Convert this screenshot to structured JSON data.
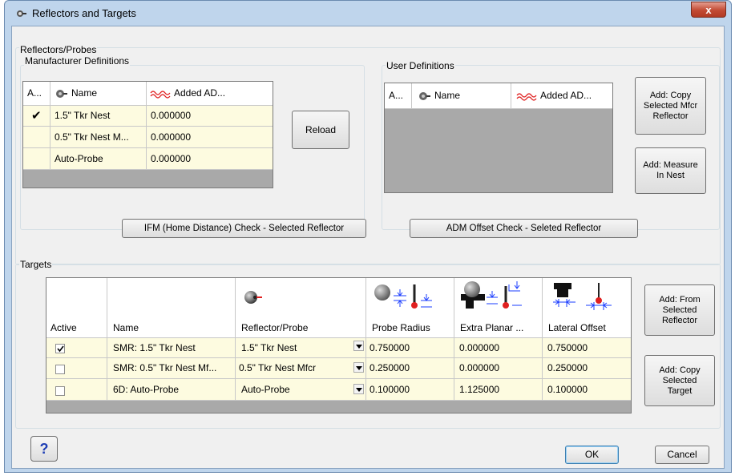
{
  "window": {
    "title": "Reflectors and Targets",
    "close": "x"
  },
  "reflectors": {
    "group_label": "Reflectors/Probes",
    "manufacturer": {
      "label": "Manufacturer Definitions",
      "columns": [
        "A...",
        "Name",
        "Added AD..."
      ],
      "rows": [
        {
          "active": "✔",
          "name": "1.5\" Tkr Nest",
          "added": "0.000000"
        },
        {
          "active": "",
          "name": "0.5\" Tkr Nest M...",
          "added": "0.000000"
        },
        {
          "active": "",
          "name": "Auto-Probe",
          "added": "0.000000"
        }
      ]
    },
    "reload_label": "Reload",
    "user": {
      "label": "User Definitions",
      "columns": [
        "A...",
        "Name",
        "Added AD..."
      ]
    },
    "add_copy_mfcr": [
      "Add: Copy",
      "Selected Mfcr",
      "Reflector"
    ],
    "add_measure": [
      "Add: Measure",
      "In Nest"
    ],
    "ifm_check_label": "IFM (Home Distance) Check - Selected Reflector",
    "adm_check_label": "ADM Offset Check - Seleted Reflector"
  },
  "targets": {
    "group_label": "Targets",
    "columns": [
      "Active",
      "Name",
      "Reflector/Probe",
      "Probe Radius",
      "Extra Planar ...",
      "Lateral Offset"
    ],
    "rows": [
      {
        "active": true,
        "name": "SMR: 1.5\" Tkr Nest",
        "reflector": "1.5\" Tkr Nest",
        "radius": "0.750000",
        "extra": "0.000000",
        "lateral": "0.750000"
      },
      {
        "active": false,
        "name": "SMR: 0.5\" Tkr Nest Mf...",
        "reflector": "0.5\" Tkr Nest Mfcr",
        "radius": "0.250000",
        "extra": "0.000000",
        "lateral": "0.250000"
      },
      {
        "active": false,
        "name": "6D: Auto-Probe",
        "reflector": "Auto-Probe",
        "radius": "0.100000",
        "extra": "1.125000",
        "lateral": "0.100000"
      }
    ],
    "add_from_selected": [
      "Add: From",
      "Selected",
      "Reflector"
    ],
    "add_copy_target": [
      "Add: Copy",
      "Selected",
      "Target"
    ]
  },
  "footer": {
    "help": "?",
    "ok": "OK",
    "cancel": "Cancel"
  },
  "colors": {
    "grid_row": "#fdfbe0",
    "grid_empty": "#a9a9a9",
    "title_bg": "#bfd5ec",
    "close_red": "#c24a33",
    "help_blue": "#1f3fb5",
    "probe_red": "#e02020",
    "dim_blue": "#1a3cff"
  },
  "icons": [
    "reflector-ball-icon",
    "wave-icon",
    "probe-radius-icon",
    "extra-planar-icon",
    "lateral-offset-icon",
    "checkmark-icon",
    "help-icon",
    "dropdown-arrow-icon"
  ]
}
